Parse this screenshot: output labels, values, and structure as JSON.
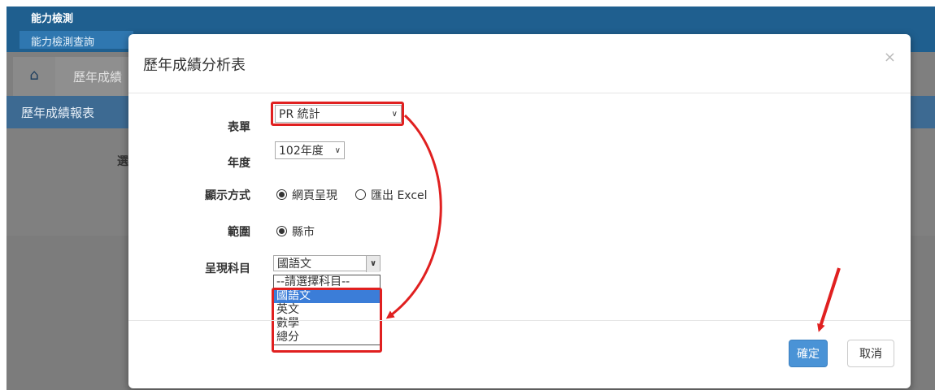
{
  "background": {
    "app_title": "能力檢測",
    "menu_item": "能力檢測查詢",
    "tab_label": "歷年成績",
    "sub_title": "歷年成績報表",
    "panel_text": "選"
  },
  "modal": {
    "title": "歷年成績分析表",
    "close_label": "×",
    "fields": {
      "form_label": "表單",
      "form_value": "PR 統計",
      "year_label": "年度",
      "year_value": "102年度",
      "display_label": "顯示方式",
      "display_option_web": "網頁呈現",
      "display_option_excel": "匯出 Excel",
      "display_selected": "網頁呈現",
      "scope_label": "範圍",
      "scope_option": "縣市",
      "subject_label": "呈現科目",
      "subject_value": "國語文"
    },
    "subject_options": [
      "--請選擇科目--",
      "國語文",
      "英文",
      "數學",
      "總分"
    ],
    "subject_highlighted": "國語文",
    "buttons": {
      "ok": "確定",
      "cancel": "取消"
    }
  },
  "colors": {
    "primary": "#4a93d6",
    "annotation": "#e02020",
    "header_blue": "#1f5f8f"
  }
}
